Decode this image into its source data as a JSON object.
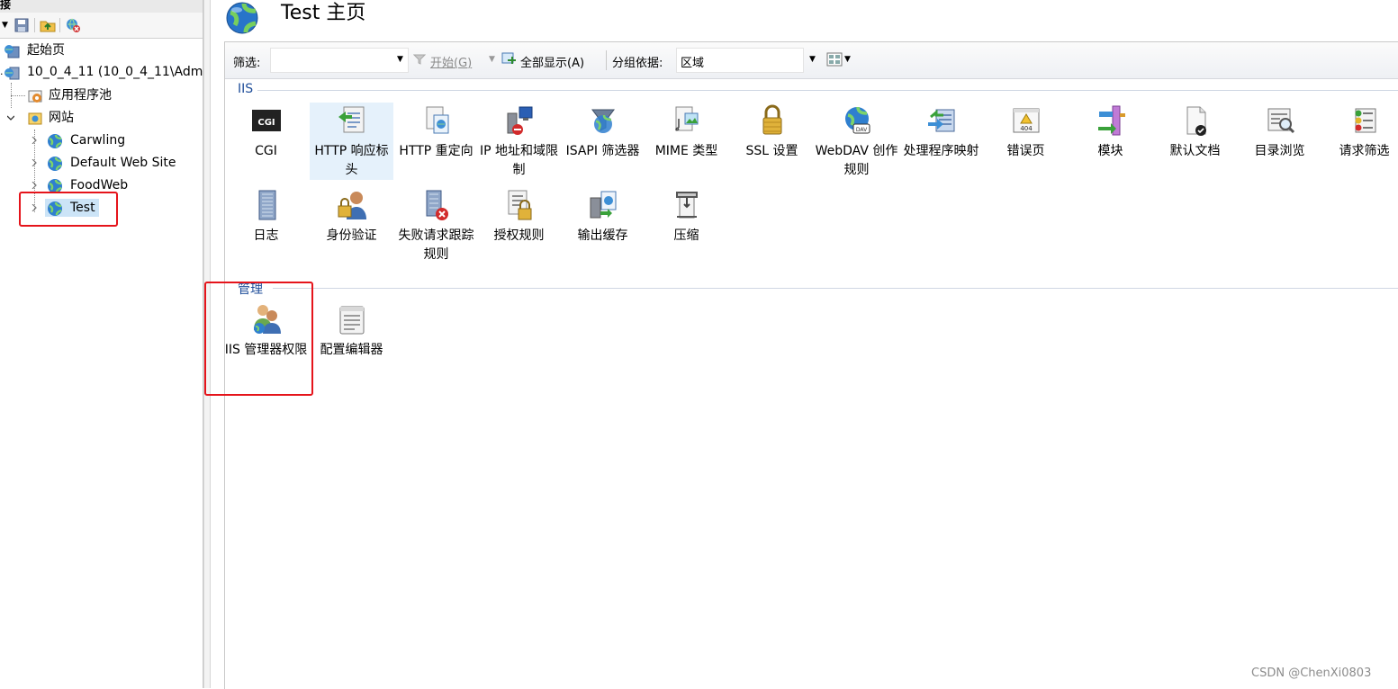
{
  "connections": {
    "header_label": "接",
    "tree": [
      {
        "label": "起始页",
        "icon": "start-page-icon"
      },
      {
        "label": "10_0_4_11 (10_0_4_11\\Adm",
        "icon": "server-icon"
      },
      {
        "label": "应用程序池",
        "icon": "app-pool-icon"
      },
      {
        "label": "网站",
        "icon": "sites-folder-icon"
      },
      {
        "label": "Carwling",
        "icon": "globe-icon"
      },
      {
        "label": "Default Web Site",
        "icon": "globe-icon"
      },
      {
        "label": "FoodWeb",
        "icon": "globe-icon"
      },
      {
        "label": "Test",
        "icon": "globe-icon",
        "selected": true
      }
    ]
  },
  "page": {
    "title": "Test 主页",
    "title_icon": "globe-icon"
  },
  "filterbar": {
    "filter_label": "筛选:",
    "filter_value": "",
    "start_label": "开始(G)",
    "show_all_label": "全部显示(A)",
    "group_by_label": "分组依据:",
    "group_by_value": "区域"
  },
  "groups": {
    "iis": {
      "name": "IIS",
      "features": [
        {
          "label": "CGI",
          "icon": "cgi-icon"
        },
        {
          "label": "HTTP 响应标头",
          "icon": "http-response-headers-icon",
          "selected": true
        },
        {
          "label": "HTTP 重定向",
          "icon": "http-redirect-icon"
        },
        {
          "label": "IP 地址和域限制",
          "icon": "ip-restrictions-icon"
        },
        {
          "label": "ISAPI 筛选器",
          "icon": "isapi-filters-icon"
        },
        {
          "label": "MIME 类型",
          "icon": "mime-types-icon"
        },
        {
          "label": "SSL 设置",
          "icon": "lock-icon"
        },
        {
          "label": "WebDAV 创作规则",
          "icon": "webdav-icon"
        },
        {
          "label": "处理程序映射",
          "icon": "handler-mappings-icon"
        },
        {
          "label": "错误页",
          "icon": "error-pages-icon"
        },
        {
          "label": "模块",
          "icon": "modules-icon"
        },
        {
          "label": "默认文档",
          "icon": "default-document-icon"
        },
        {
          "label": "目录浏览",
          "icon": "directory-browsing-icon"
        },
        {
          "label": "请求筛选",
          "icon": "request-filtering-icon"
        },
        {
          "label": "日志",
          "icon": "logging-icon"
        },
        {
          "label": "身份验证",
          "icon": "authentication-icon"
        },
        {
          "label": "失败请求跟踪规则",
          "icon": "failed-request-tracing-icon"
        },
        {
          "label": "授权规则",
          "icon": "authorization-rules-icon"
        },
        {
          "label": "输出缓存",
          "icon": "output-caching-icon"
        },
        {
          "label": "压缩",
          "icon": "compression-icon"
        }
      ]
    },
    "management": {
      "name": "管理",
      "features": [
        {
          "label": "IIS 管理器权限",
          "icon": "iis-manager-permissions-icon",
          "highlighted": true
        },
        {
          "label": "配置编辑器",
          "icon": "configuration-editor-icon"
        }
      ]
    }
  },
  "watermark": "CSDN @ChenXi0803",
  "colors": {
    "highlight_border": "#e5141b",
    "group_header": "#1f4e9a",
    "selection": "#e5f1fb"
  }
}
